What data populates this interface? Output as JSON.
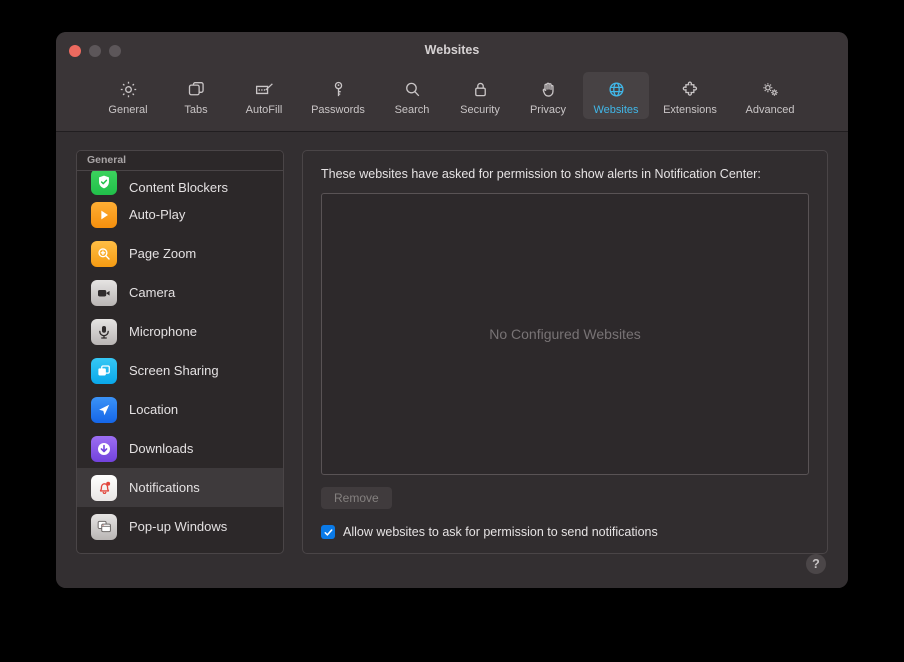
{
  "window": {
    "title": "Websites",
    "traffic_lights": [
      "close",
      "minimize",
      "zoom"
    ]
  },
  "toolbar": {
    "items": [
      {
        "label": "General",
        "icon": "gear-icon",
        "selected": false
      },
      {
        "label": "Tabs",
        "icon": "tabs-icon",
        "selected": false
      },
      {
        "label": "AutoFill",
        "icon": "autofill-icon",
        "selected": false
      },
      {
        "label": "Passwords",
        "icon": "key-icon",
        "selected": false
      },
      {
        "label": "Search",
        "icon": "search-icon",
        "selected": false
      },
      {
        "label": "Security",
        "icon": "lock-icon",
        "selected": false
      },
      {
        "label": "Privacy",
        "icon": "hand-icon",
        "selected": false
      },
      {
        "label": "Websites",
        "icon": "globe-icon",
        "selected": true
      },
      {
        "label": "Extensions",
        "icon": "puzzle-icon",
        "selected": false
      },
      {
        "label": "Advanced",
        "icon": "gears-icon",
        "selected": false
      }
    ]
  },
  "sidebar": {
    "header": "General",
    "items": [
      {
        "label": "Content Blockers",
        "icon": "shield-check-icon",
        "selected": false
      },
      {
        "label": "Auto-Play",
        "icon": "play-icon",
        "selected": false
      },
      {
        "label": "Page Zoom",
        "icon": "magnifier-plus-icon",
        "selected": false
      },
      {
        "label": "Camera",
        "icon": "camera-icon",
        "selected": false
      },
      {
        "label": "Microphone",
        "icon": "microphone-icon",
        "selected": false
      },
      {
        "label": "Screen Sharing",
        "icon": "screen-share-icon",
        "selected": false
      },
      {
        "label": "Location",
        "icon": "location-arrow-icon",
        "selected": false
      },
      {
        "label": "Downloads",
        "icon": "download-icon",
        "selected": false
      },
      {
        "label": "Notifications",
        "icon": "bell-icon",
        "selected": true
      },
      {
        "label": "Pop-up Windows",
        "icon": "popup-window-icon",
        "selected": false
      }
    ]
  },
  "main": {
    "title": "These websites have asked for permission to show alerts in Notification Center:",
    "empty_state": "No Configured Websites",
    "remove_button": "Remove",
    "remove_enabled": false,
    "checkbox": {
      "label": "Allow websites to ask for permission to send notifications",
      "checked": true
    }
  },
  "help_button": {
    "glyph": "?"
  },
  "colors": {
    "accent": "#41b7e8",
    "checkbox_blue": "#0a7ae8",
    "window_bg": "#332f31",
    "titlebar_bg": "#3a3537",
    "close_red": "#ec6a5f"
  }
}
